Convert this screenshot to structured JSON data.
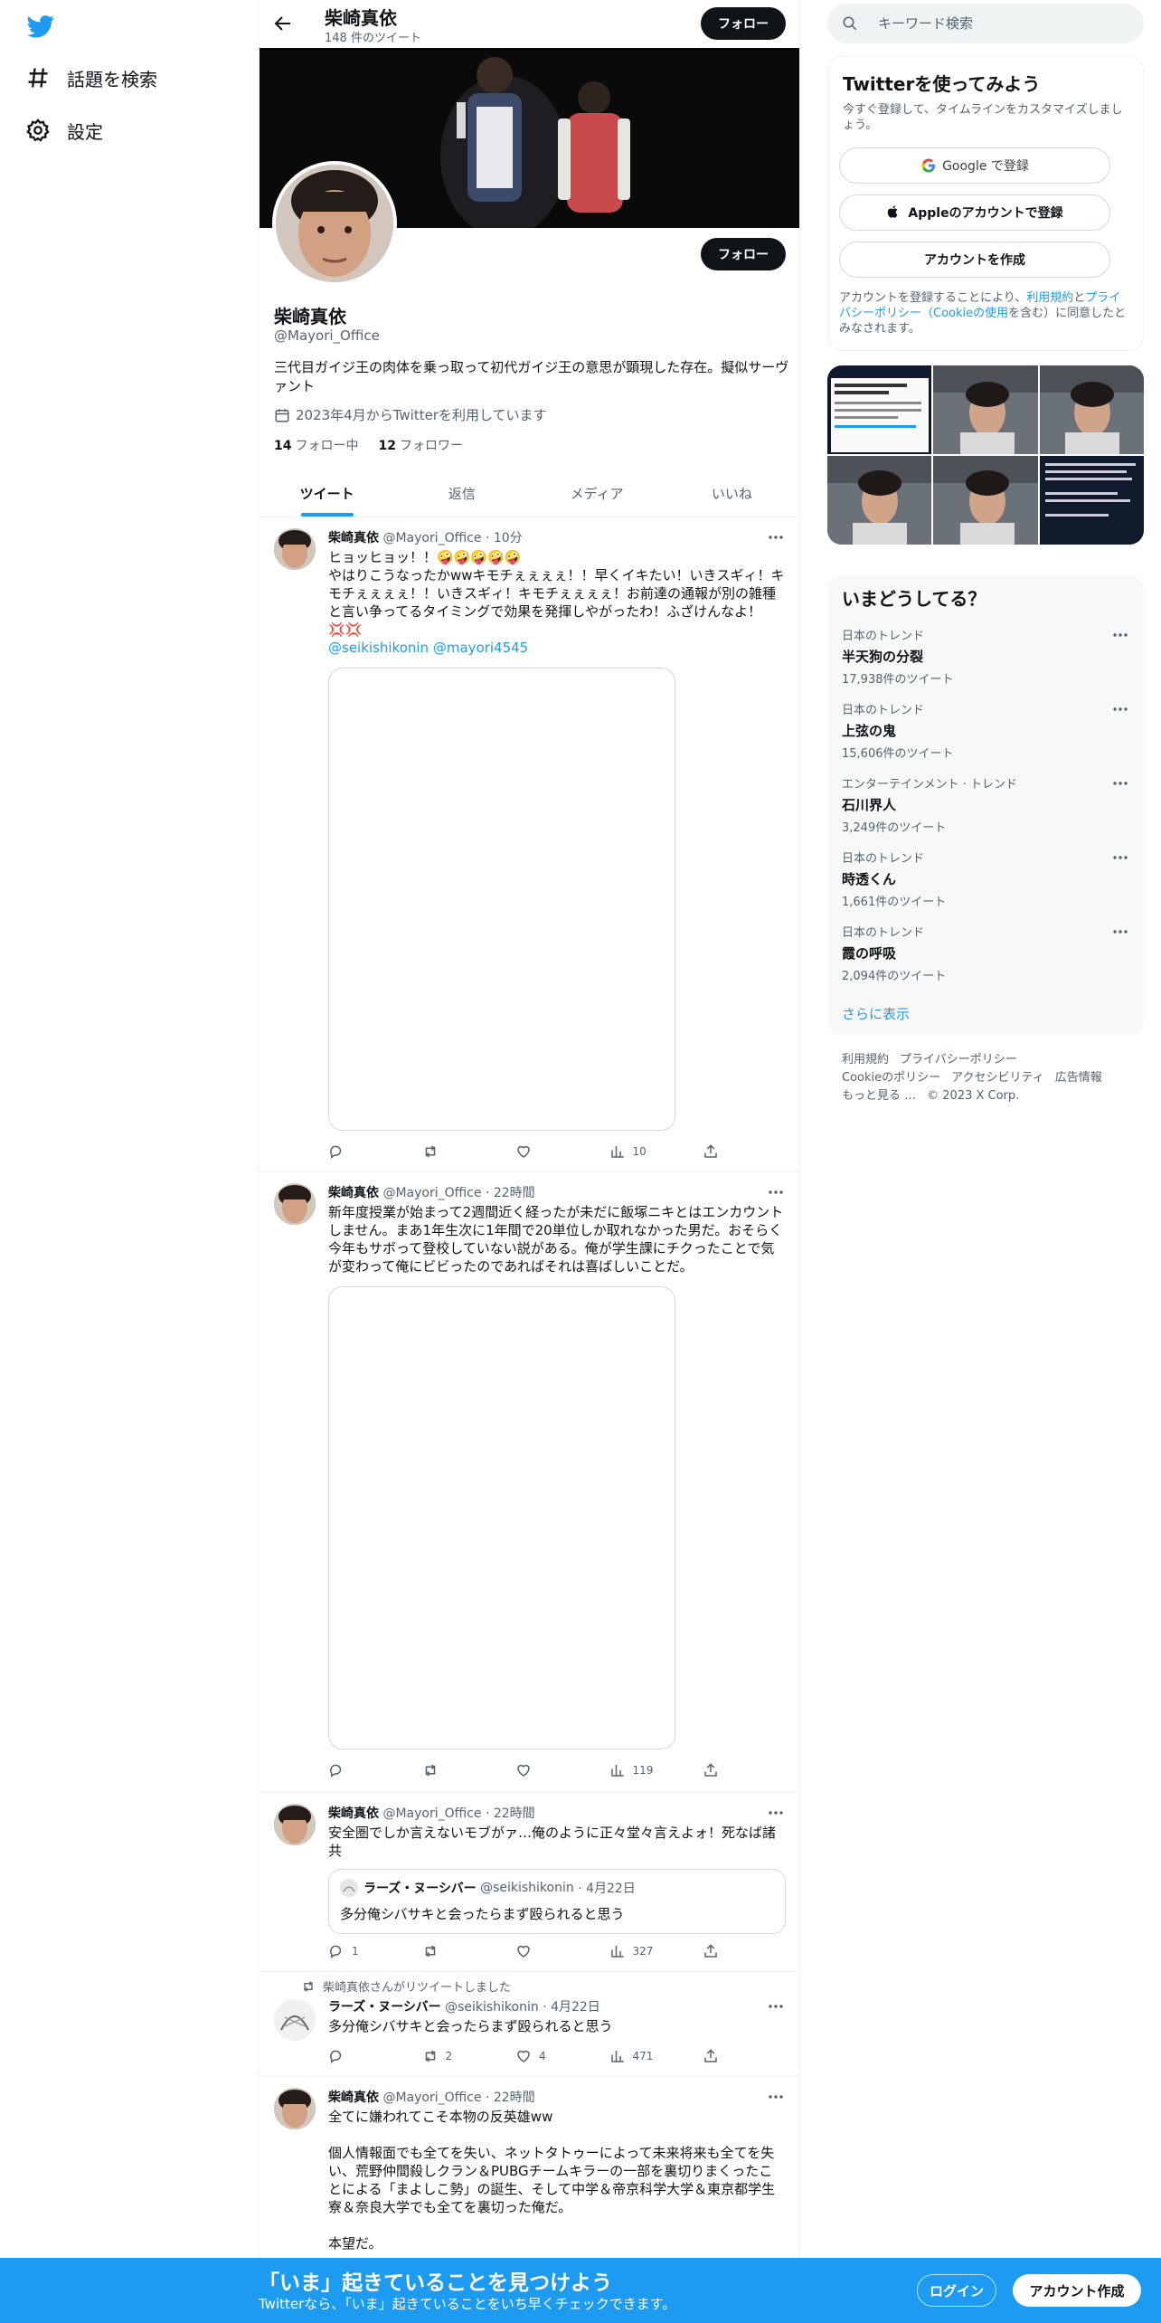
{
  "colors": {
    "accent": "#1d9bf0",
    "text": "#0f1419",
    "muted": "#536471",
    "button_dark": "#0f1419"
  },
  "nav": {
    "logo_icon": "twitter-bird-icon",
    "items": [
      {
        "label": "話題を検索",
        "icon": "hashtag-icon"
      },
      {
        "label": "設定",
        "icon": "gear-icon"
      }
    ]
  },
  "header": {
    "name": "柴崎真依",
    "tweet_count": "148 件のツイート",
    "follow_label": "フォロー"
  },
  "profile": {
    "name": "柴崎真依",
    "handle": "@Mayori_Office",
    "bio": "三代目ガイジ王の肉体を乗っ取って初代ガイジ王の意思が顕現した存在。擬似サーヴァント",
    "joined": "2023年4月からTwitterを利用しています",
    "following_count": "14",
    "following_label": "フォロー中",
    "followers_count": "12",
    "followers_label": "フォロワー",
    "follow_label": "フォロー"
  },
  "tabs": [
    "ツイート",
    "返信",
    "メディア",
    "いいね"
  ],
  "tweets": [
    {
      "name": "柴崎真依",
      "handle": "@Mayori_Office",
      "time": "· 10分",
      "text": "ヒョッヒョッ！！🤪🤪🤪🤪🤪\nやはりこうなったかwwキモチぇぇぇぇ！！早くイキたい！いきスギィ！キモチぇぇぇぇ！！いきスギィ！キモチぇぇぇぇ！お前達の通報が別の雑種と言い争ってるタイミングで効果を発揮しやがったわ！ふざけんなよ！💢💢",
      "mentions": "@seikishikonin @mayori4545",
      "reply_count": "",
      "retweet_count": "",
      "like_count": "",
      "view_count": "10"
    },
    {
      "name": "柴崎真依",
      "handle": "@Mayori_Office",
      "time": "· 22時間",
      "text": "新年度授業が始まって2週間近く経ったが未だに飯塚ニキとはエンカウントしません。まあ1年生次に1年間で20単位しか取れなかった男だ。おそらく今年もサボって登校していない説がある。俺が学生課にチクったことで気が変わって俺にビビったのであればそれは喜ばしいことだ。",
      "reply_count": "",
      "retweet_count": "",
      "like_count": "",
      "view_count": "119"
    },
    {
      "name": "柴崎真依",
      "handle": "@Mayori_Office",
      "time": "· 22時間",
      "text": "安全圏でしか言えないモブがァ…俺のように正々堂々言えよォ！死なば諸共",
      "quote": {
        "name": "ラーズ・ヌーシバー",
        "handle": "@seikishikonin",
        "time": "· 4月22日",
        "text": "多分俺シバサキと会ったらまず殴られると思う"
      },
      "reply_count": "1",
      "retweet_count": "",
      "like_count": "",
      "view_count": "327"
    },
    {
      "retweeted_by": "柴崎真依さんがリツイートしました",
      "name": "ラーズ・ヌーシバー",
      "handle": "@seikishikonin",
      "time": "· 4月22日",
      "text": "多分俺シバサキと会ったらまず殴られると思う",
      "reply_count": "",
      "retweet_count": "2",
      "like_count": "4",
      "view_count": "471"
    },
    {
      "name": "柴崎真依",
      "handle": "@Mayori_Office",
      "time": "· 22時間",
      "text": "全てに嫌われてこそ本物の反英雄ww\n\n個人情報面でも全てを失い、ネットタトゥーによって未来将来も全てを失い、荒野仲間殺しクラン＆PUBGチームキラーの一部を裏切りまくったことによる「まよしこ勢」の誕生、そして中学＆帝京科学大学＆東京都学生寮＆奈良大学でも全てを裏切った俺だ。\n\n本望だ。"
    }
  ],
  "search": {
    "placeholder": "キーワード検索"
  },
  "signup": {
    "title": "Twitterを使ってみよう",
    "subtitle": "今すぐ登録して、タイムラインをカスタマイズしましょう。",
    "google_label": "Google で登録",
    "apple_label": "Appleのアカウントで登録",
    "create_label": "アカウントを作成",
    "terms_prefix": "アカウントを登録することにより、",
    "terms_link": "利用規約",
    "terms_and": "と",
    "privacy_link": "プライバシーポリシー（Cookieの使用",
    "terms_suffix": "を含む）に同意したとみなされます。"
  },
  "trends": {
    "title": "いまどうしてる？",
    "items": [
      {
        "context": "日本のトレンド",
        "name": "半天狗の分裂",
        "count": "17,938件のツイート"
      },
      {
        "context": "日本のトレンド",
        "name": "上弦の鬼",
        "count": "15,606件のツイート"
      },
      {
        "context": "エンターテインメント · トレンド",
        "name": "石川界人",
        "count": "3,249件のツイート"
      },
      {
        "context": "日本のトレンド",
        "name": "時透くん",
        "count": "1,661件のツイート"
      },
      {
        "context": "日本のトレンド",
        "name": "霞の呼吸",
        "count": "2,094件のツイート"
      }
    ],
    "show_more": "さらに表示"
  },
  "footer": {
    "links": [
      "利用規約",
      "プライバシーポリシー",
      "Cookieのポリシー",
      "アクセシビリティ",
      "広告情報",
      "もっと見る …"
    ],
    "copyright": "© 2023 X Corp."
  },
  "bottombar": {
    "title": "「いま」起きていることを見つけよう",
    "subtitle": "Twitterなら、「いま」起きていることをいち早くチェックできます。",
    "login_label": "ログイン",
    "signup_label": "アカウント作成"
  }
}
